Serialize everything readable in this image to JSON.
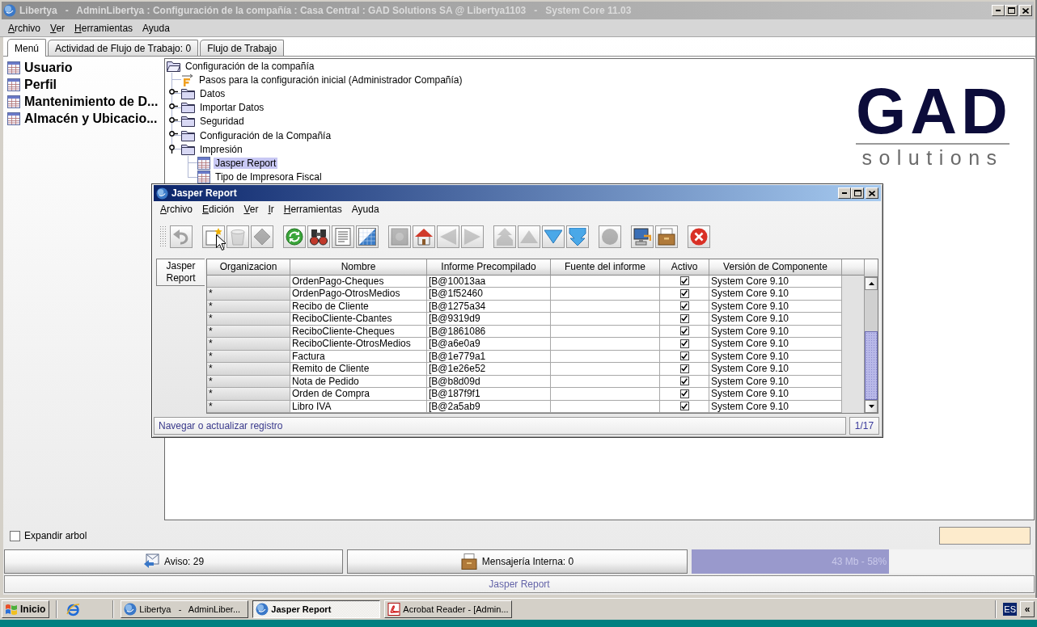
{
  "main_window": {
    "title": "Libertya   -   AdminLibertya : Configuración de la compañía : Casa Central : GAD Solutions SA @ Libertya1103   -   System Core 11.03",
    "active": false,
    "menu": [
      {
        "label": "Archivo",
        "mnemonic": true
      },
      {
        "label": "Ver",
        "mnemonic": true
      },
      {
        "label": "Herramientas",
        "mnemonic": true
      },
      {
        "label": "Ayuda",
        "mnemonic": false
      }
    ],
    "tabs": [
      {
        "label": "Menú",
        "selected": true
      },
      {
        "label": "Actividad de Flujo de Trabajo: 0",
        "selected": false
      },
      {
        "label": "Flujo de Trabajo",
        "selected": false
      }
    ],
    "sidebar": {
      "items": [
        {
          "label": "Usuario"
        },
        {
          "label": "Perfil"
        },
        {
          "label": "Mantenimiento de D..."
        },
        {
          "label": "Almacén y Ubicacio..."
        }
      ]
    },
    "tree": [
      {
        "kind": "folder",
        "label": "Configuración de la compañía",
        "expanded": true,
        "selected": false,
        "children": [
          {
            "kind": "workflow",
            "label": "Pasos para la configuración inicial (Administrador Compañía)",
            "selected": false
          },
          {
            "kind": "folder",
            "label": "Datos",
            "expanded": false,
            "selected": false
          },
          {
            "kind": "folder",
            "label": "Importar Datos",
            "expanded": false,
            "selected": false
          },
          {
            "kind": "folder",
            "label": "Seguridad",
            "expanded": false,
            "selected": false
          },
          {
            "kind": "folder",
            "label": "Configuración de la Compañía",
            "expanded": false,
            "selected": false
          },
          {
            "kind": "folder",
            "label": "Impresión",
            "expanded": true,
            "selected": false,
            "children": [
              {
                "kind": "window",
                "label": "Jasper Report",
                "selected": true
              },
              {
                "kind": "window",
                "label": "Tipo de Impresora Fiscal",
                "selected": false
              }
            ]
          }
        ]
      }
    ],
    "logo": {
      "mark": "GAD",
      "tagline": "solutions"
    },
    "expand_tree": {
      "label": "Expandir arbol",
      "checked": false
    },
    "status_buttons": [
      {
        "kind": "notice",
        "label": "Aviso: 29"
      },
      {
        "kind": "messages",
        "label": "Mensajería Interna: 0"
      }
    ],
    "memory": {
      "reading": "43 Mb - 58%",
      "level": 0.58
    },
    "status_bar": "Jasper Report"
  },
  "report_window": {
    "title": "Jasper Report",
    "active": true,
    "menu": [
      {
        "label": "Archivo",
        "mnemonic": true
      },
      {
        "label": "Edición",
        "mnemonic": true
      },
      {
        "label": "Ver",
        "mnemonic": true
      },
      {
        "label": "Ir",
        "mnemonic": true
      },
      {
        "label": "Herramientas",
        "mnemonic": true
      },
      {
        "label": "Ayuda",
        "mnemonic": false
      }
    ],
    "toolbar": [
      [
        {
          "kind": "undo",
          "disabled": true
        }
      ],
      [
        {
          "kind": "new",
          "disabled": false
        },
        {
          "kind": "delete",
          "disabled": true
        },
        {
          "kind": "save",
          "disabled": true
        }
      ],
      [
        {
          "kind": "refresh",
          "disabled": false
        },
        {
          "kind": "find",
          "disabled": false
        },
        {
          "kind": "detail",
          "disabled": false
        },
        {
          "kind": "grid",
          "disabled": false
        }
      ],
      [
        {
          "kind": "parent",
          "disabled": true
        },
        {
          "kind": "home",
          "disabled": false
        },
        {
          "kind": "back",
          "disabled": true
        },
        {
          "kind": "forward",
          "disabled": true
        }
      ],
      [
        {
          "kind": "first",
          "disabled": true
        },
        {
          "kind": "previous",
          "disabled": true
        },
        {
          "kind": "next",
          "disabled": false
        },
        {
          "kind": "last",
          "disabled": false
        }
      ],
      [
        {
          "kind": "zoom",
          "disabled": true
        }
      ],
      [
        {
          "kind": "export",
          "disabled": false
        },
        {
          "kind": "archive",
          "disabled": false
        }
      ],
      [
        {
          "kind": "close",
          "disabled": false
        }
      ]
    ],
    "side_tabs": [
      {
        "label": "Jasper Report",
        "selected": true
      }
    ],
    "table": {
      "columns": [
        "Organizacion",
        "Nombre",
        "Informe Precompilado",
        "Fuente del informe",
        "Activo",
        "Versión de Componente"
      ],
      "rows": [
        {
          "nombre": "OrdenPago-Cheques",
          "informe_precompilado": "[B@10013aa",
          "activo": true,
          "version": "System Core 9.10"
        },
        {
          "organizacion": "*",
          "nombre": "OrdenPago-OtrosMedios",
          "informe_precompilado": "[B@1f52460",
          "activo": true,
          "version": "System Core 9.10"
        },
        {
          "organizacion": "*",
          "nombre": "Recibo de Cliente",
          "informe_precompilado": "[B@1275a34",
          "activo": true,
          "version": "System Core 9.10"
        },
        {
          "organizacion": "*",
          "nombre": "ReciboCliente-Cbantes",
          "informe_precompilado": "[B@9319d9",
          "activo": true,
          "version": "System Core 9.10"
        },
        {
          "organizacion": "*",
          "nombre": "ReciboCliente-Cheques",
          "informe_precompilado": "[B@1861086",
          "activo": true,
          "version": "System Core 9.10"
        },
        {
          "organizacion": "*",
          "nombre": "ReciboCliente-OtrosMedios",
          "informe_precompilado": "[B@a6e0a9",
          "activo": true,
          "version": "System Core 9.10"
        },
        {
          "organizacion": "*",
          "nombre": "Factura",
          "informe_precompilado": "[B@1e779a1",
          "activo": true,
          "version": "System Core 9.10"
        },
        {
          "organizacion": "*",
          "nombre": "Remito de Cliente",
          "informe_precompilado": "[B@1e26e52",
          "activo": true,
          "version": "System Core 9.10"
        },
        {
          "organizacion": "*",
          "nombre": "Nota de Pedido",
          "informe_precompilado": "[B@b8d09d",
          "activo": true,
          "version": "System Core 9.10"
        },
        {
          "organizacion": "*",
          "nombre": "Orden de Compra",
          "informe_precompilado": "[B@187f9f1",
          "activo": true,
          "version": "System Core 9.10"
        },
        {
          "organizacion": "*",
          "nombre": "Libro IVA",
          "informe_precompilado": "[B@2a5ab9",
          "activo": true,
          "version": "System Core 9.10"
        }
      ]
    },
    "status": "Navegar o actualizar registro",
    "record": "1/17"
  },
  "taskbar": {
    "start": "Inicio",
    "tasks": [
      {
        "kind": "libertya",
        "label": "Libertya   -   AdminLiber...",
        "selected": false
      },
      {
        "kind": "libertya",
        "label": "Jasper Report",
        "selected": true
      },
      {
        "kind": "acrobat",
        "label": "Acrobat Reader - [Admin...",
        "selected": false
      }
    ],
    "language": "ES",
    "tray_toggle": "«"
  }
}
